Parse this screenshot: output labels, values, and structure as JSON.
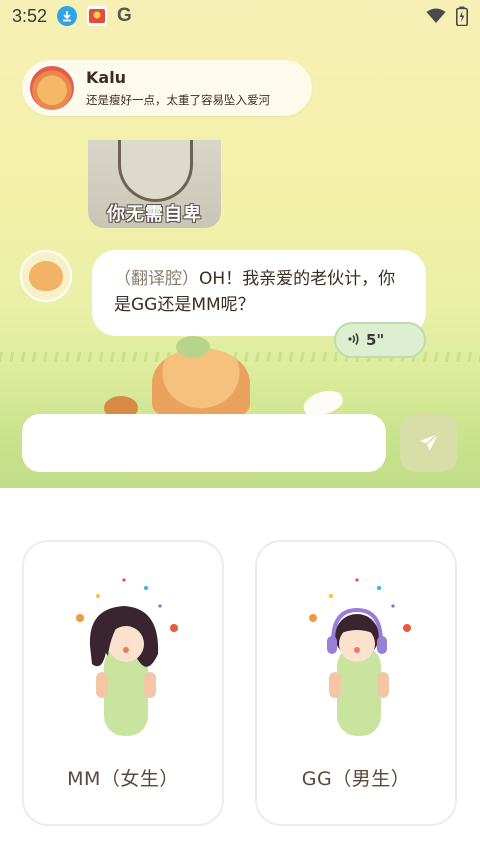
{
  "status_bar": {
    "time": "3:52",
    "icons": [
      "download-icon",
      "app-icon-red",
      "google-g-icon"
    ],
    "google_letter": "G",
    "right_icons": [
      "wifi-icon",
      "battery-icon"
    ]
  },
  "notification": {
    "name": "Kalu",
    "message": "还是瘦好一点，太重了容易坠入爱河"
  },
  "sticker": {
    "caption": "你无需自卑"
  },
  "chat": {
    "prefix": "（翻译腔）",
    "message": "OH！我亲爱的老伙计，你是GG还是MM呢？",
    "voice_duration": "5\""
  },
  "input": {
    "placeholder": ""
  },
  "options": [
    {
      "label": "MM（女生）"
    },
    {
      "label": "GG（男生）"
    }
  ],
  "colors": {
    "accent_green": "#c7e29c",
    "send_button": "#d7dea7",
    "text_brown": "#5b4838",
    "voice_bg": "#ddeed1"
  }
}
